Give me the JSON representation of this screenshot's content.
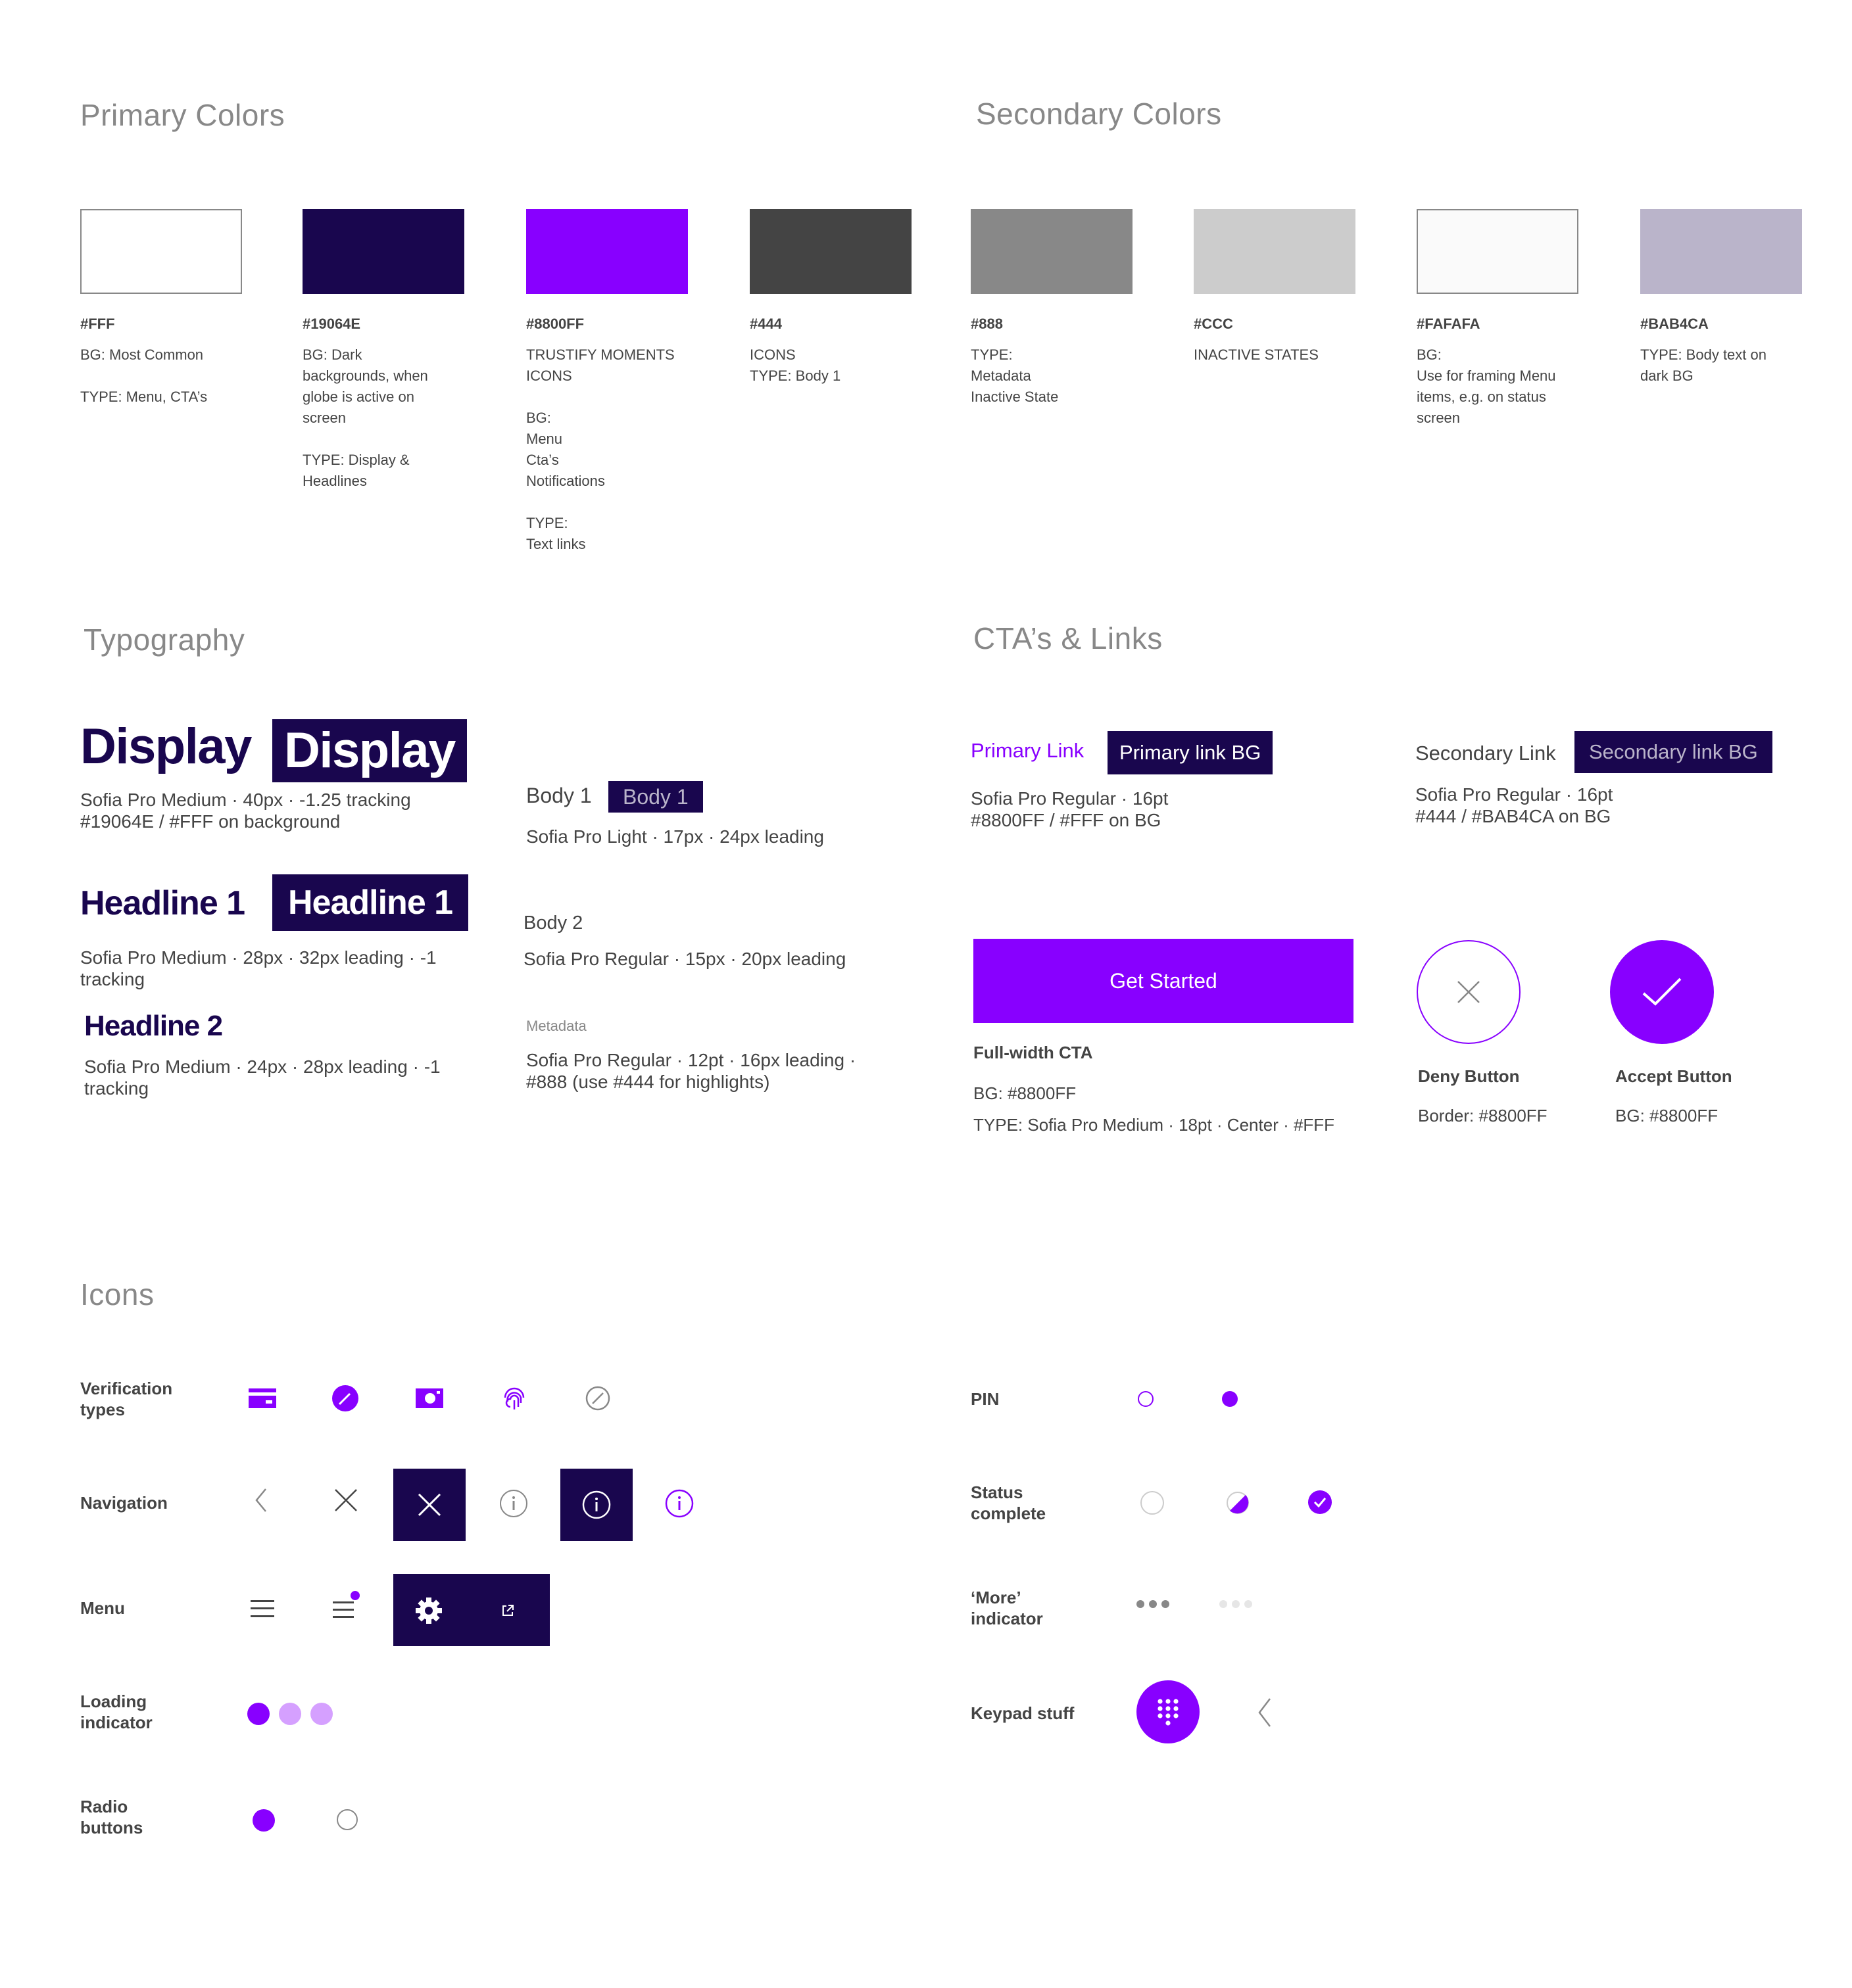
{
  "colors": {
    "brand_purple": "#8800FF",
    "brand_navy": "#19064E",
    "text_dark": "#444444",
    "text_meta": "#888888",
    "lavender": "#BAB4CA",
    "light_purple": "#D5A0FF"
  },
  "primary": {
    "title": "Primary Colors",
    "swatches": [
      {
        "hex": "#FFF",
        "color": "#FFFFFF",
        "lines": [
          "BG: Most Common",
          "",
          "TYPE: Menu, CTA’s"
        ]
      },
      {
        "hex": "#19064E",
        "color": "#19064E",
        "lines": [
          "BG: Dark",
          "backgrounds, when",
          "globe is active on",
          "screen",
          "",
          "TYPE: Display &",
          "Headlines"
        ]
      },
      {
        "hex": "#8800FF",
        "color": "#8800FF",
        "lines": [
          "TRUSTIFY MOMENTS",
          "ICONS",
          "",
          "BG:",
          "Menu",
          "Cta’s",
          "Notifications",
          "",
          "TYPE:",
          "Text links"
        ]
      },
      {
        "hex": "#444",
        "color": "#444444",
        "lines": [
          "ICONS",
          "TYPE: Body 1"
        ]
      }
    ]
  },
  "secondary": {
    "title": "Secondary Colors",
    "swatches": [
      {
        "hex": "#888",
        "color": "#888888",
        "lines": [
          "TYPE:",
          "Metadata",
          "Inactive State"
        ]
      },
      {
        "hex": "#CCC",
        "color": "#CCCCCC",
        "lines": [
          "INACTIVE STATES"
        ]
      },
      {
        "hex": "#FAFAFA",
        "color": "#FAFAFA",
        "lines": [
          "BG:",
          "Use for framing Menu",
          "items, e.g. on status",
          "screen"
        ]
      },
      {
        "hex": "#BAB4CA",
        "color": "#BAB4CA",
        "lines": [
          "TYPE: Body text on",
          "dark BG"
        ]
      }
    ]
  },
  "typography": {
    "title": "Typography",
    "display": {
      "label": "Display",
      "spec_line1": "Sofia Pro Medium · 40px · -1.25 tracking",
      "spec_line2": "#19064E / #FFF on background"
    },
    "headline1": {
      "label": "Headline 1",
      "spec_line1": "Sofia Pro Medium · 28px · 32px leading · -1",
      "spec_line2": "tracking"
    },
    "headline2": {
      "label": "Headline 2",
      "spec_line1": "Sofia Pro Medium · 24px · 28px leading · -1",
      "spec_line2": "tracking"
    },
    "body1": {
      "label": "Body 1",
      "spec": "Sofia Pro Light · 17px · 24px leading"
    },
    "body2": {
      "label": "Body 2",
      "spec": "Sofia Pro Regular · 15px · 20px leading"
    },
    "metadata": {
      "label": "Metadata",
      "spec_line1": "Sofia Pro Regular · 12pt · 16px leading ·",
      "spec_line2": "#888 (use #444 for highlights)"
    }
  },
  "ctas": {
    "title": "CTA’s & Links",
    "primary_link": {
      "label": "Primary Link",
      "bg_label": "Primary link BG",
      "spec_line1": "Sofia Pro Regular · 16pt",
      "spec_line2": "#8800FF / #FFF on BG"
    },
    "secondary_link": {
      "label": "Secondary Link",
      "bg_label": "Secondary link BG",
      "spec_line1": "Sofia Pro Regular · 16pt",
      "spec_line2": "#444 / #BAB4CA on BG"
    },
    "full_width": {
      "button_label": "Get Started",
      "name": "Full-width CTA",
      "bg": "BG: #8800FF",
      "type": "TYPE: Sofia Pro Medium · 18pt · Center · #FFF"
    },
    "deny": {
      "name": "Deny Button",
      "spec": "Border: #8800FF"
    },
    "accept": {
      "name": "Accept Button",
      "spec": "BG: #8800FF"
    }
  },
  "icons": {
    "title": "Icons",
    "rows": {
      "verification": "Verification\ntypes",
      "navigation": "Navigation",
      "menu": "Menu",
      "loading": "Loading\nindicator",
      "radio": "Radio\nbuttons",
      "pin": "PIN",
      "status": "Status\ncomplete",
      "more": "‘More’\nindicator",
      "keypad": "Keypad stuff"
    },
    "icon_names": [
      "card-icon",
      "pen-icon",
      "camera-icon",
      "fingerprint-icon",
      "disabled-icon",
      "back-icon",
      "close-icon",
      "info-icon",
      "settings-icon",
      "external-link-icon",
      "hamburger-icon",
      "keypad-icon"
    ]
  }
}
